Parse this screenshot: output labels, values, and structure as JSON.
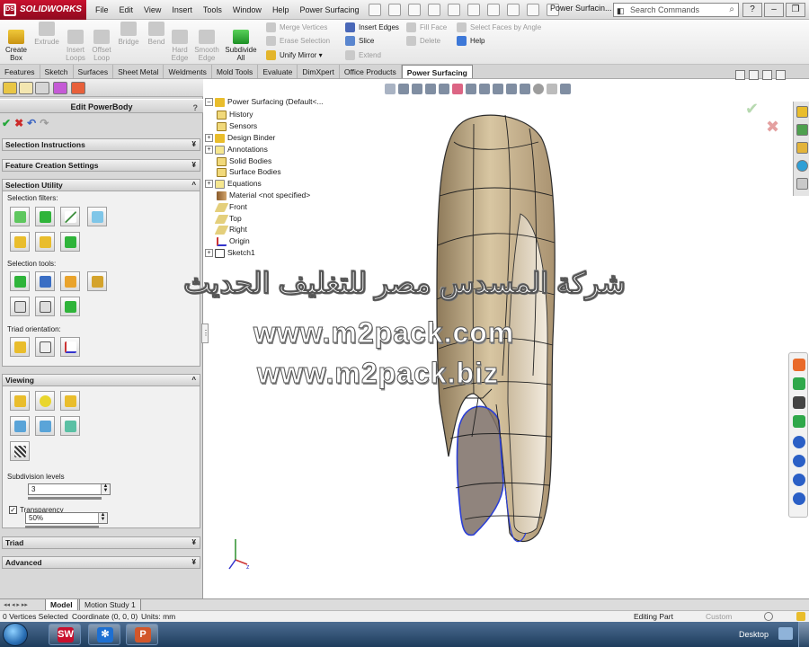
{
  "title_bar": {
    "app_name": "SOLIDWORKS",
    "menus": [
      "File",
      "Edit",
      "View",
      "Insert",
      "Tools",
      "Window",
      "Help",
      "Power Surfacing"
    ],
    "document_title": "Power Surfacin...",
    "search_placeholder": "Search Commands"
  },
  "ribbon": {
    "create_box": "Create\nBox",
    "extrude": "Extrude",
    "insert_loops": "Insert\nLoops",
    "offset_loop": "Offset\nLoop",
    "bridge": "Bridge",
    "bend": "Bend",
    "hard_edge": "Hard\nEdge",
    "smooth_edge": "Smooth\nEdge",
    "subdivide_all": "Subdivide\nAll",
    "merge_vertices": "Merge Vertices",
    "erase_selection": "Erase Selection",
    "unify_mirror": "Unify Mirror",
    "insert_edges": "Insert Edges",
    "slice": "Slice",
    "extend": "Extend",
    "fill_face": "Fill Face",
    "delete": "Delete",
    "select_faces_by_angle": "Select Faces by Angle",
    "help": "Help"
  },
  "command_tabs": [
    "Features",
    "Sketch",
    "Surfaces",
    "Sheet Metal",
    "Weldments",
    "Mold Tools",
    "Evaluate",
    "DimXpert",
    "Office Products",
    "Power Surfacing"
  ],
  "active_command_tab": "Power Surfacing",
  "property_manager": {
    "title": "Edit PowerBody",
    "help_glyph": "?",
    "groups": {
      "selection_instructions": "Selection Instructions",
      "feature_creation_settings": "Feature Creation Settings",
      "selection_utility": "Selection Utility",
      "viewing": "Viewing",
      "triad": "Triad",
      "advanced": "Advanced"
    },
    "labels": {
      "selection_filters": "Selection filters:",
      "selection_tools": "Selection tools:",
      "triad_orientation": "Triad orientation:",
      "subdivision_levels": "Subdivision levels",
      "transparency": "Transparency"
    },
    "subdivision_levels_value": "3",
    "transparency_value": "50%",
    "transparency_checked": true,
    "transparency_fraction": 0.5,
    "subdivision_fraction": 0.0
  },
  "feature_tree": {
    "root": "Power Surfacing  (Default<...",
    "items": [
      {
        "label": "History",
        "expandable": false
      },
      {
        "label": "Sensors",
        "expandable": false
      },
      {
        "label": "Design Binder",
        "expandable": true
      },
      {
        "label": "Annotations",
        "expandable": true
      },
      {
        "label": "Solid Bodies",
        "expandable": false
      },
      {
        "label": "Surface Bodies",
        "expandable": false
      },
      {
        "label": "Equations",
        "expandable": true
      },
      {
        "label": "Material <not specified>",
        "expandable": false
      },
      {
        "label": "Front",
        "expandable": false
      },
      {
        "label": "Top",
        "expandable": false
      },
      {
        "label": "Right",
        "expandable": false
      },
      {
        "label": "Origin",
        "expandable": false
      },
      {
        "label": "Sketch1",
        "expandable": true
      }
    ]
  },
  "watermark": {
    "arabic": "شركة المسدس مصر للتغليف الحديث",
    "url_com": "www.m2pack.com",
    "url_biz": "www.m2pack.biz"
  },
  "bottom_tabs": [
    "Model",
    "Motion Study 1"
  ],
  "status_bar": {
    "selected": "0 Vertices Selected",
    "coordinate": "Coordinate (0, 0, 0)",
    "units": "Units: mm",
    "mode": "Editing Part",
    "custom": "Custom"
  },
  "taskbar": {
    "desktop_label": "Desktop",
    "apps": [
      "SolidWorks",
      "Snowflake",
      "PowerPoint"
    ]
  },
  "colors": {
    "model_fill": "#c9b48f",
    "model_shadow": "#8e7a5a",
    "selected_face": "#7d6f66",
    "selection_edge": "#2b3fd6",
    "accent_green": "#25a83b",
    "accent_red": "#cc2a2a"
  }
}
